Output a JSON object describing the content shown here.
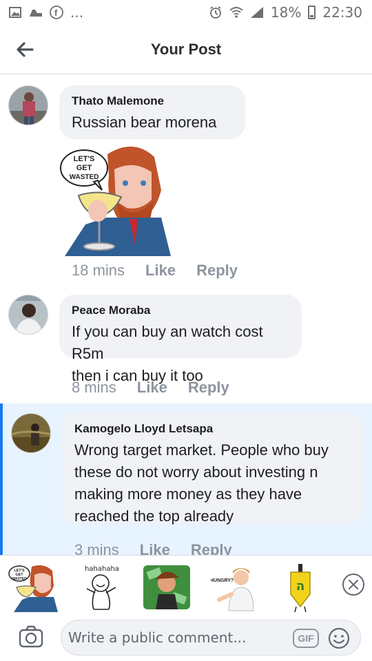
{
  "status_bar": {
    "battery": "18%",
    "time": "22:30",
    "dots": "..."
  },
  "header": {
    "title": "Your Post",
    "back_icon": "arrow-left-icon"
  },
  "comments": [
    {
      "author": "Thato Malemone",
      "text": "Russian bear morena",
      "sticker": "lets-get-wasted-sticker",
      "sticker_caption": "LET'S GET WASTED",
      "time": "18 mins",
      "like": "Like",
      "reply": "Reply"
    },
    {
      "author": "Peace Moraba",
      "text_lines": [
        "If you can buy an watch cost R5m",
        "then i can buy it too"
      ],
      "time": "8 mins",
      "like": "Like",
      "reply": "Reply"
    },
    {
      "author": "Kamogelo Lloyd Letsapa",
      "text_lines": [
        "Wrong target market. People who buy",
        "these do not worry about investing n",
        "making more money as they have",
        "reached the top already"
      ],
      "time": "3 mins",
      "like": "Like",
      "reply": "Reply",
      "highlighted": true
    }
  ],
  "sticker_tray": {
    "stickers": [
      {
        "name": "lets-get-wasted-sticker",
        "caption": "LET'S GET WASTED"
      },
      {
        "name": "hahahaha-sticker",
        "caption": "hahahaha"
      },
      {
        "name": "money-sticker",
        "caption": ""
      },
      {
        "name": "hungry-sticker",
        "caption": "HUNGRY?"
      },
      {
        "name": "dreidel-sticker",
        "caption": ""
      }
    ],
    "close_icon": "close-circle-icon"
  },
  "composer": {
    "placeholder": "Write a public comment...",
    "gif_label": "GIF",
    "camera_icon": "camera-icon",
    "emoji_icon": "smiley-icon"
  },
  "colors": {
    "accent": "#1877f2",
    "bubble": "#f0f2f5",
    "highlight_bg": "#e7f3ff",
    "meta_text": "#8d949e"
  }
}
